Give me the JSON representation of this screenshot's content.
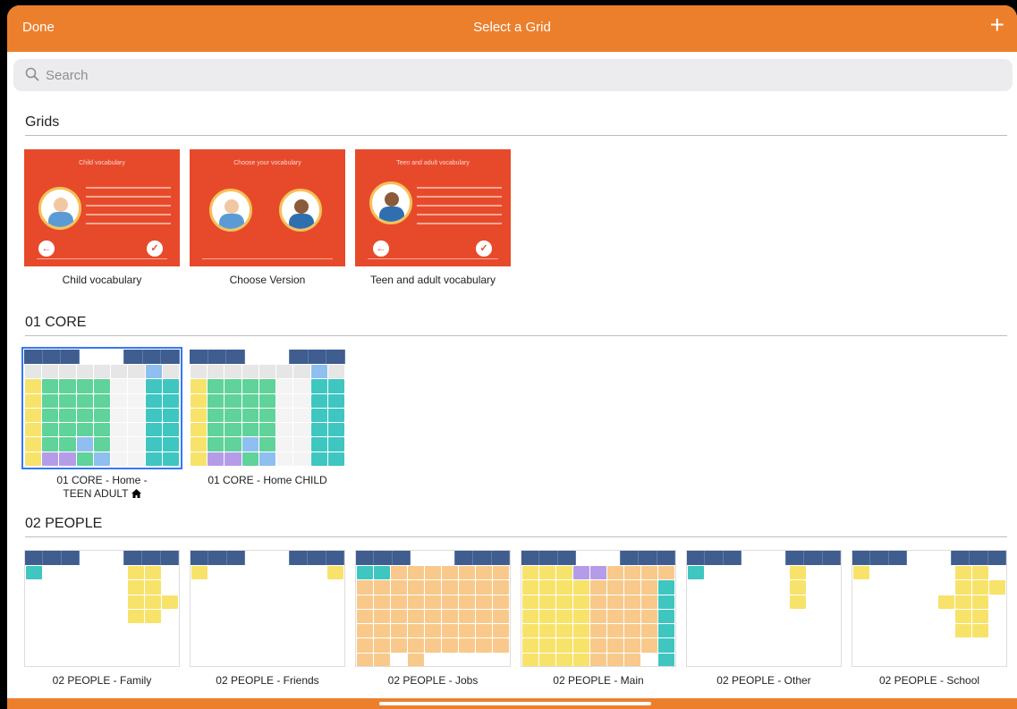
{
  "topbar": {
    "done_label": "Done",
    "title": "Select a Grid",
    "add_label": "+"
  },
  "search": {
    "placeholder": "Search",
    "value": ""
  },
  "sections": [
    {
      "title": "Grids",
      "items": [
        {
          "label": "Child vocabulary",
          "thumb_title": "Child vocabulary"
        },
        {
          "label": "Choose Version",
          "thumb_title": "Choose your vocabulary"
        },
        {
          "label": "Teen and adult vocabulary",
          "thumb_title": "Teen and adult vocabulary"
        }
      ]
    },
    {
      "title": "01 CORE",
      "items": [
        {
          "label": "01 CORE - Home -",
          "label2": "TEEN ADULT",
          "home_icon": "home-icon"
        },
        {
          "label": "01 CORE - Home CHILD"
        }
      ]
    },
    {
      "title": "02 PEOPLE",
      "items": [
        {
          "label": "02 PEOPLE - Family"
        },
        {
          "label": "02 PEOPLE - Friends"
        },
        {
          "label": "02 PEOPLE - Jobs"
        },
        {
          "label": "02 PEOPLE - Main"
        },
        {
          "label": "02 PEOPLE - Other"
        },
        {
          "label": "02 PEOPLE - School"
        }
      ]
    }
  ],
  "colors": {
    "accent": "#ec7f2c",
    "thumb_red": "#e74a2b",
    "toolbar": "#3f5d8f",
    "selection": "#3478f6"
  }
}
